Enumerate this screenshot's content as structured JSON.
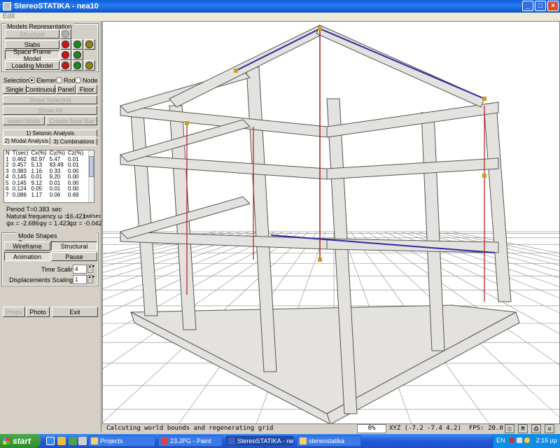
{
  "window": {
    "title": "StereoSTATIKA - nea10",
    "menu_edit": "Edit"
  },
  "models": {
    "group_title": "Models Representation",
    "structure": "Structure",
    "slabs": "Slabs",
    "space_frame": "Space Frame Model",
    "loading": "Loading Model"
  },
  "selection": {
    "label": "Selection:",
    "opt_element": "Element",
    "opt_rod": "Rod",
    "opt_node": "Node",
    "single": "Single",
    "continuous": "Continuous",
    "panel": "Panel",
    "floor": "Floor",
    "show_selected": "Show Selectnd",
    "show_all": "Show All",
    "insert_node": "Insert Node",
    "create_new_bar": "Create New Bar"
  },
  "analysis_tabs": {
    "seismic": "1) Seismic Analysis",
    "modal": "2) Modal Analysis",
    "combinations": "3) Combinations"
  },
  "modal_table": {
    "headers": [
      "N",
      "T(sec)",
      "Cx(%)",
      "Cy(%)",
      "Cz(%)"
    ],
    "rows": [
      [
        "1",
        "0.462",
        "82.97",
        "5.47",
        "0.01"
      ],
      [
        "2",
        "0.457",
        "5.13",
        "83.49",
        "0.01"
      ],
      [
        "3",
        "0.383",
        "1.16",
        "0.33",
        "0.00"
      ],
      [
        "4",
        "0.145",
        "0.01",
        "9.20",
        "0.00"
      ],
      [
        "5",
        "0.145",
        "9.12",
        "0.01",
        "0.00"
      ],
      [
        "6",
        "0.124",
        "0.05",
        "0.01",
        "0.00"
      ],
      [
        "7",
        "0.086",
        "1.17",
        "0.06",
        "0.69"
      ]
    ]
  },
  "results": {
    "period_label": "Period T=",
    "period_value": "0.383",
    "period_unit": "sec",
    "natfreq_label": "Natural frequency ω =",
    "natfreq_value": "16.421",
    "natfreq_unit": "rad/sec",
    "psi_x": "ψx = -2.686",
    "psi_y": "ψy = 1.423",
    "psi_z": "ψz = -0.042"
  },
  "mode_shapes": {
    "group_title": "Mode Shapes Representation",
    "wireframe": "Wireframe",
    "structural": "Structural",
    "animation": "Animation",
    "pause": "Pause",
    "time_scaling_label": "Time Scaling:",
    "time_scaling_value": "4",
    "disp_scaling_label": "Displacements Scaling:",
    "disp_scaling_value": "1"
  },
  "bottom_buttons": {
    "props": "Props",
    "photo": "Photo",
    "exit": "Exit"
  },
  "statusbar": {
    "message": "Calcuting world bounds and regenerating grid",
    "percent": "0%",
    "xyz": "XYZ (-7.2 -7.4 4.2)",
    "fps": "FPS: 20.0",
    "m_label": "M"
  },
  "taskbar": {
    "start": "start",
    "tasks": [
      "Projects",
      "23.JPG - Paint",
      "StereoSTATIKA - nea10",
      "stereostatika"
    ],
    "lang": "EN",
    "clock": "2:16 μμ"
  },
  "colors": {
    "frame_fill": "#e4e2de",
    "frame_edge": "#555555",
    "blue_member": "#2a2aa0",
    "red_member": "#b01818",
    "node": "#c8a020",
    "grid": "#9a9a9a"
  }
}
